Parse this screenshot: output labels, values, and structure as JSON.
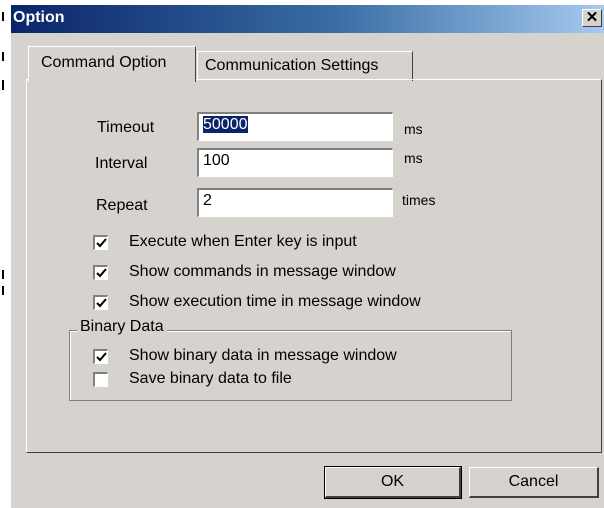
{
  "window": {
    "title": "Option",
    "close_glyph": "✕"
  },
  "tabs": [
    {
      "label": "Command Option",
      "active": true
    },
    {
      "label": "Communication Settings",
      "active": false
    }
  ],
  "fields": [
    {
      "label": "Timeout",
      "value": "50000",
      "unit": "ms"
    },
    {
      "label": "Interval",
      "value": "100",
      "unit": "ms"
    },
    {
      "label": "Repeat",
      "value": "2",
      "unit": "times"
    }
  ],
  "options": [
    {
      "label": "Execute when Enter key is input",
      "checked": true
    },
    {
      "label": "Show commands in message window",
      "checked": true
    },
    {
      "label": "Show execution time in message window",
      "checked": true
    }
  ],
  "binary_group": {
    "title": "Binary Data",
    "options": [
      {
        "label": "Show binary data in message window",
        "checked": true
      },
      {
        "label": "Save binary data to file",
        "checked": false
      }
    ]
  },
  "buttons": {
    "ok": "OK",
    "cancel": "Cancel"
  }
}
